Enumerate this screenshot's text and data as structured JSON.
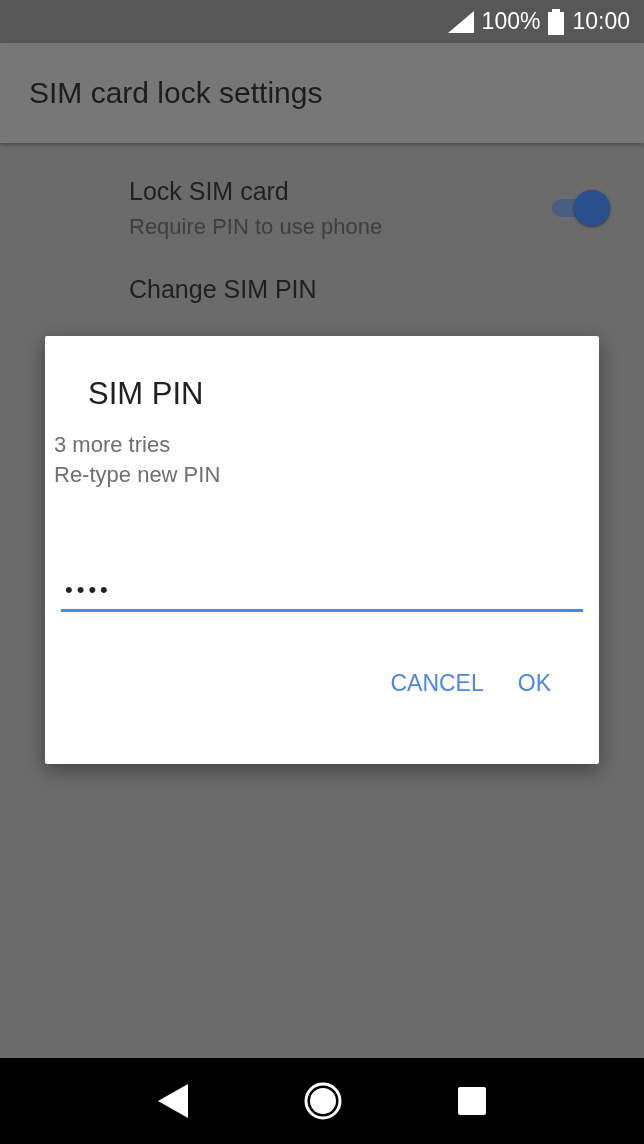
{
  "status_bar": {
    "battery": "100%",
    "time": "10:00"
  },
  "app_bar": {
    "title": "SIM card lock settings"
  },
  "settings": [
    {
      "kind": "switch",
      "title": "Lock SIM card",
      "summary": "Require PIN to use phone",
      "on": true
    },
    {
      "kind": "plain",
      "title": "Change SIM PIN"
    }
  ],
  "dialog": {
    "title": "SIM PIN",
    "messages": [
      "3 more tries",
      "Re-type new PIN"
    ],
    "pin_field": {
      "value": "••••"
    },
    "buttons": [
      "CANCEL",
      "OK"
    ]
  }
}
